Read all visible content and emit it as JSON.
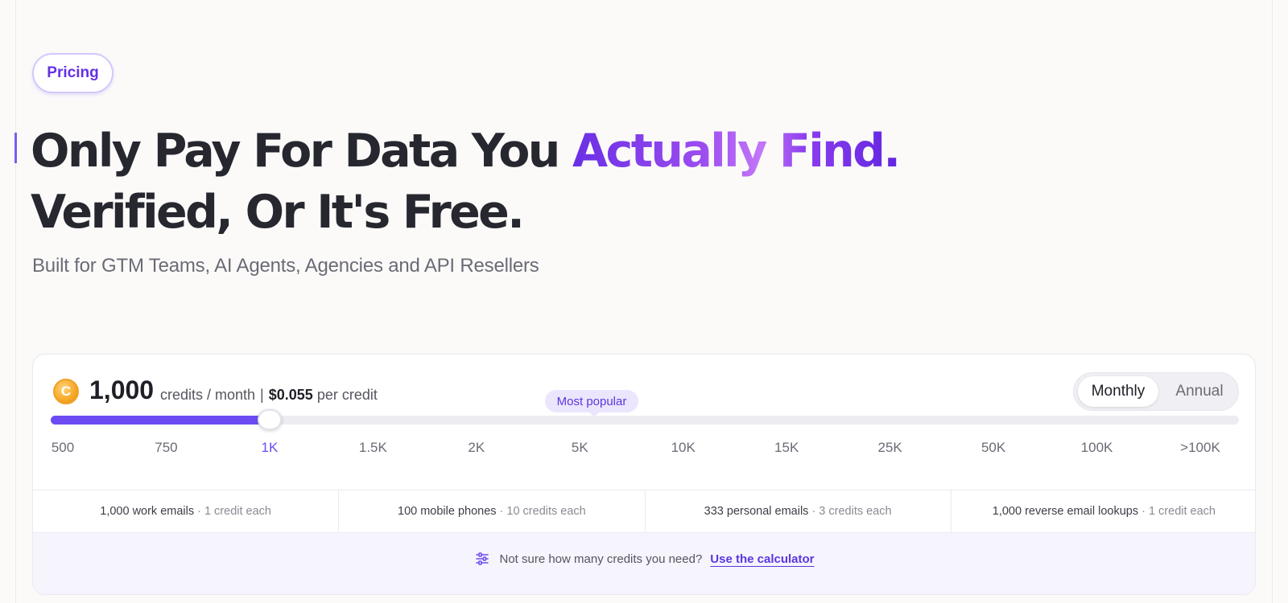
{
  "badge": {
    "label": "Pricing"
  },
  "hero": {
    "headline_part1": "Only Pay For Data You ",
    "headline_accent": "Actually Find.",
    "headline_line2": "Verified, Or It's Free.",
    "subheadline": "Built for GTM Teams, AI Agents, Agencies and API Resellers"
  },
  "pricing": {
    "coin_symbol": "C",
    "credits": "1,000",
    "credits_unit": "credits / month",
    "separator": "|",
    "price": "$0.055",
    "price_unit": "per credit",
    "billing_toggle": {
      "monthly": "Monthly",
      "annual": "Annual",
      "selected": "Monthly"
    },
    "most_popular": "Most popular",
    "slider": {
      "ticks": [
        "500",
        "750",
        "1K",
        "1.5K",
        "2K",
        "5K",
        "10K",
        "15K",
        "25K",
        "50K",
        "100K",
        ">100K"
      ],
      "selected_index": 2,
      "popular_index": 5
    },
    "features": [
      {
        "label": "1,000 work emails",
        "note": "· 1 credit each"
      },
      {
        "label": "100 mobile phones",
        "note": "· 10 credits each"
      },
      {
        "label": "333 personal emails",
        "note": "· 3 credits each"
      },
      {
        "label": "1,000 reverse email lookups",
        "note": "· 1 credit each"
      }
    ],
    "calculator": {
      "prompt": "Not sure how many credits you need?",
      "link": "Use the calculator",
      "icon": "sliders-icon"
    }
  },
  "colors": {
    "accent": "#6d4bf2",
    "brand_purple": "#6431e6",
    "text": "#27272f",
    "muted": "#6b6b76"
  }
}
